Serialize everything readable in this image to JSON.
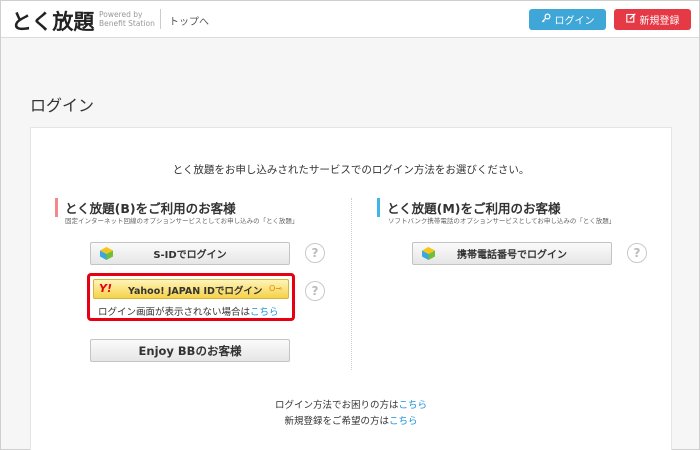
{
  "header": {
    "logo": "とく放題",
    "logo_sub": "Powered by Benefit Station",
    "top_link": "トップへ",
    "login_label": "ログイン",
    "register_label": "新規登録"
  },
  "page": {
    "title": "ログイン",
    "intro": "とく放題をお申し込みされたサービスでのログイン方法をお選びください。"
  },
  "column_b": {
    "title": "とく放題(B)をご利用のお客様",
    "subtitle": "固定インターネット回線のオプションサービスとしてお申し込みの「とく放題」",
    "sid_button": "S-IDでログイン",
    "yahoo_mark": "Y!",
    "yahoo_button": "Yahoo! JAPAN IDでログイン",
    "yahoo_key_icon": "O⊸",
    "yahoo_note_prefix": "ログイン画面が表示されない場合は",
    "yahoo_note_link": "こちら",
    "enjoy_button": "Enjoy BBのお客様"
  },
  "column_m": {
    "title": "とく放題(M)をご利用のお客様",
    "subtitle": "ソフトバンク携帯電話のオプションサービスとしてお申し込みの「とく放題」",
    "phone_button": "携帯電話番号でログイン"
  },
  "footer": {
    "trouble_prefix": "ログイン方法でお困りの方は",
    "trouble_link": "こちら",
    "register_prefix": "新規登録をご希望の方は",
    "register_link": "こちら"
  },
  "help_mark": "?",
  "colors": {
    "login_blue": "#3fa6d8",
    "register_red": "#e53a46",
    "highlight_red": "#e60012",
    "link_blue": "#1a8fd8"
  }
}
